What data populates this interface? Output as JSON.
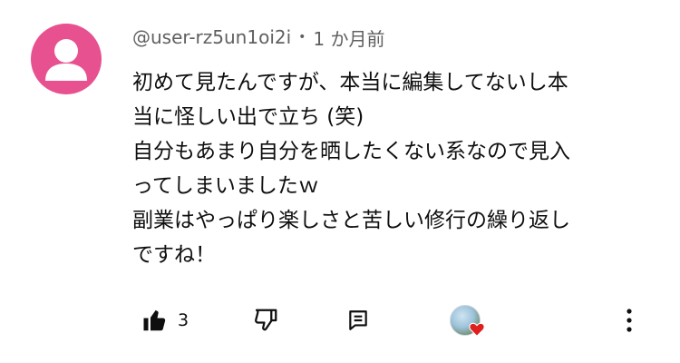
{
  "comment": {
    "author": "@user-rz5un1oi2i",
    "separator": "•",
    "timestamp": "1 か月前",
    "text_lines": [
      "初めて見たんですが、本当に編集してないし本",
      "当に怪しい出で立ち (笑)",
      "自分もあまり自分を晒したくない系なので見入",
      "ってしまいましたｗ",
      "副業はやっぱり楽しさと苦しい修行の繰り返し",
      "ですね！"
    ]
  },
  "actions": {
    "like_count": "3",
    "like_icon": "thumbs-up-icon",
    "dislike_icon": "thumbs-down-icon",
    "reply_icon": "reply-comment-icon",
    "creator_heart_icon": "heart-icon",
    "more_icon": "more-vertical-icon"
  },
  "colors": {
    "avatar_bg": "#e8518f",
    "meta_text": "#606060",
    "heart": "#e01e1e"
  }
}
